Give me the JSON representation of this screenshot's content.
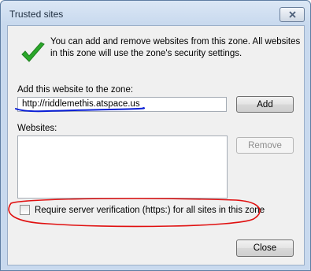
{
  "window": {
    "title": "Trusted sites"
  },
  "info": {
    "text": "You can add and remove websites from this zone. All websites in this zone will use the zone's security settings.",
    "icon": "checkmark-icon",
    "icon_color": "#2aa82a"
  },
  "add_site": {
    "label": "Add this website to the zone:",
    "value": "http://riddlemethis.atspace.us",
    "add_button": "Add"
  },
  "websites": {
    "label": "Websites:",
    "items": [],
    "remove_button": "Remove"
  },
  "https_option": {
    "label": "Require server verification (https:) for all sites in this zone",
    "checked": false
  },
  "footer": {
    "close_button": "Close"
  },
  "annotations": {
    "underline_color": "#0a1fd6",
    "ellipse_color": "#e01010"
  }
}
